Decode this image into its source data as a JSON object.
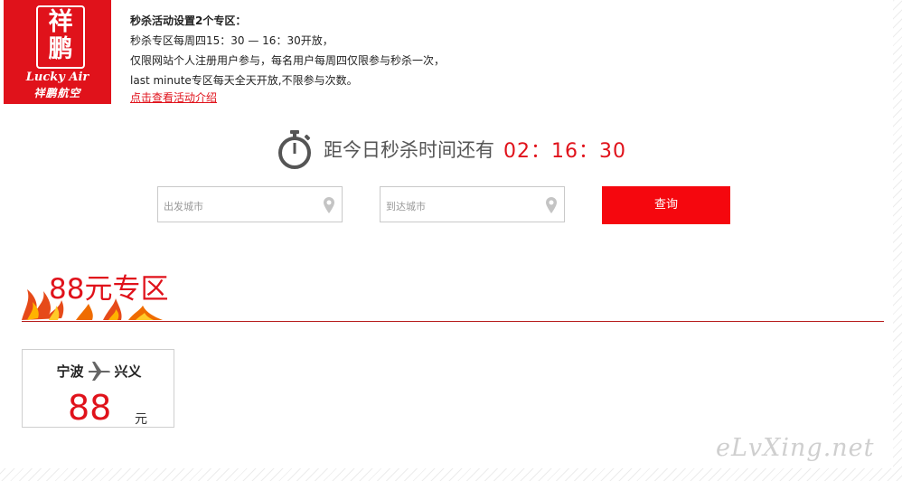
{
  "logo": {
    "seal_chars": [
      "祥",
      "鹏"
    ],
    "brand_en": "Lucky Air",
    "brand_cn": "祥鹏航空"
  },
  "intro": {
    "title": "秒杀活动设置2个专区：",
    "line1": "秒杀专区每周四15：30 — 16：30开放，",
    "line2": "仅限网站个人注册用户参与，每名用户每周四仅限参与秒杀一次，",
    "line3": "last minute专区每天全天开放,不限参与次数。",
    "link": "点击查看活动介绍"
  },
  "countdown": {
    "label": "距今日秒杀时间还有",
    "time": "02：16：30",
    "icon": "stopwatch-icon"
  },
  "search": {
    "origin_placeholder": "出发城市",
    "dest_placeholder": "到达城市",
    "query_label": "查询",
    "pin_icon": "map-pin-icon"
  },
  "zone": {
    "title": "88元专区"
  },
  "deals": [
    {
      "from": "宁波",
      "to": "兴义",
      "price": "88",
      "unit": "元"
    }
  ],
  "watermark": "eLvXing.net",
  "colors": {
    "brand_red": "#e0121b",
    "button_red": "#f5070e",
    "gray_text": "#555555"
  }
}
